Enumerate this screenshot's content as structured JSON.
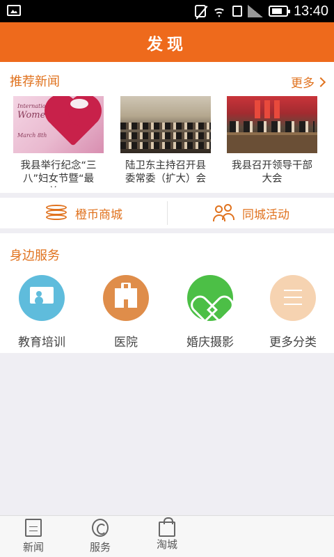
{
  "status_bar": {
    "time": "13:40",
    "icons": [
      "image-icon",
      "mute-icon",
      "wifi-icon",
      "data-icon",
      "signal-icon",
      "battery-icon"
    ]
  },
  "header": {
    "title": "发现"
  },
  "news": {
    "section_title": "推荐新闻",
    "more_label": "更多",
    "items": [
      {
        "caption": "我县举行纪念“三八”妇女节暨“最美…",
        "thumb_text_1": "International",
        "thumb_text_2": "Women's Day",
        "thumb_text_3": "March 8th"
      },
      {
        "caption": "陆卫东主持召开县委常委（扩大）会"
      },
      {
        "caption": "我县召开领导干部大会"
      }
    ]
  },
  "shortcuts": {
    "coin_mall": "橙币商城",
    "city_events": "同城活动"
  },
  "services": {
    "section_title": "身边服务",
    "items": [
      {
        "label": "教育培训",
        "icon": "teaching-icon",
        "color": "#5fbcdc"
      },
      {
        "label": "医院",
        "icon": "hospital-icon",
        "color": "#df8d4a"
      },
      {
        "label": "婚庆摄影",
        "icon": "heart-icon",
        "color": "#4cbf46"
      },
      {
        "label": "更多分类",
        "icon": "list-icon",
        "color": "#f6d3b1"
      }
    ]
  },
  "tabs": [
    {
      "label": "新闻",
      "icon": "newspaper-icon"
    },
    {
      "label": "服务",
      "icon": "service-icon"
    },
    {
      "label": "淘城",
      "icon": "shopping-bag-icon"
    }
  ],
  "colors": {
    "brand": "#ee6a1c",
    "accent_text": "#e0721e"
  }
}
